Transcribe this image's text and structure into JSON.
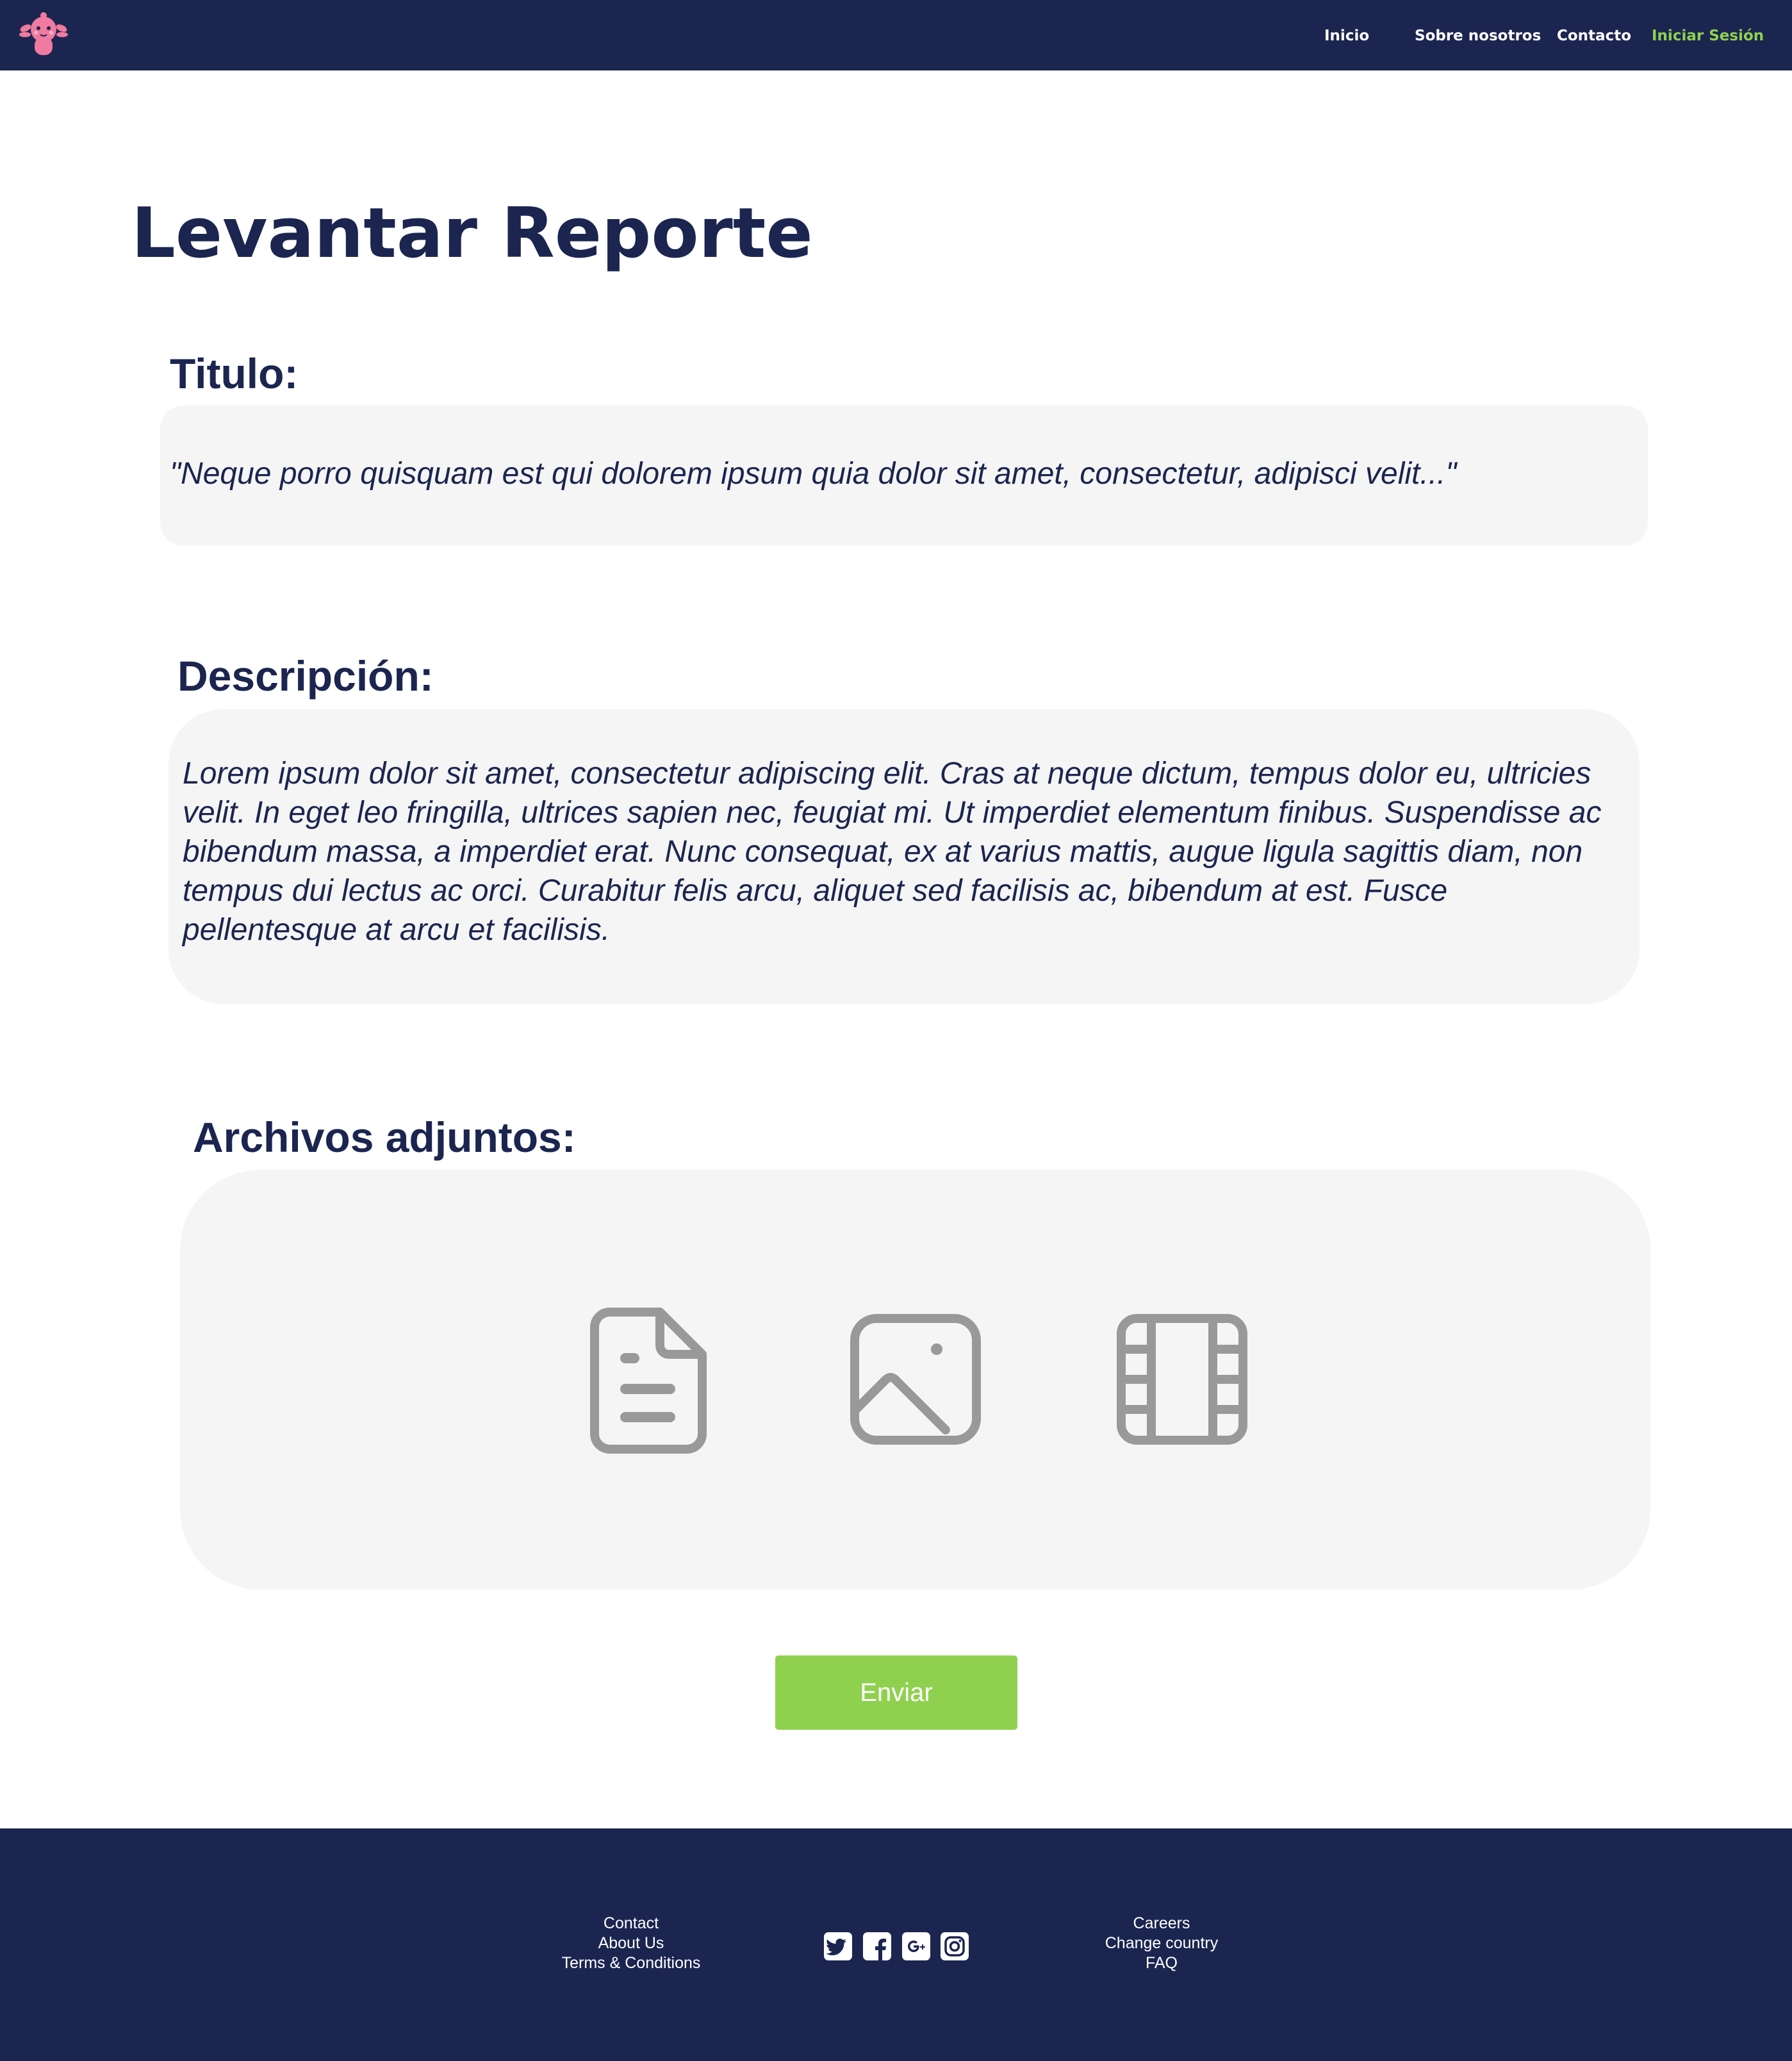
{
  "nav": {
    "logo_icon": "axolotl-logo-icon",
    "links": [
      "Inicio",
      "Sobre nosotros",
      "Contacto"
    ],
    "login_label": "Iniciar Sesión"
  },
  "page": {
    "title": "Levantar Reporte"
  },
  "form": {
    "title_label": "Titulo:",
    "title_value": "\"Neque porro quisquam est qui dolorem ipsum quia dolor sit amet, consectetur, adipisci velit...\"",
    "description_label": "Descripción:",
    "description_value": "Lorem ipsum dolor sit amet, consectetur adipiscing elit. Cras at neque dictum, tempus dolor eu, ultricies velit. In eget leo fringilla, ultrices sapien nec, feugiat mi. Ut imperdiet elementum finibus. Suspendisse ac bibendum massa, a imperdiet erat. Nunc consequat, ex at varius mattis, augue ligula sagittis diam, non tempus dui lectus ac orci. Curabitur felis arcu, aliquet sed facilisis ac, bibendum at est. Fusce pellentesque at arcu et facilisis.",
    "attachments_label": "Archivos adjuntos:",
    "attachment_icons": [
      "document-icon",
      "image-icon",
      "video-icon"
    ],
    "submit_label": "Enviar"
  },
  "footer": {
    "left_links": [
      "Contact",
      "About Us",
      "Terms & Conditions"
    ],
    "right_links": [
      "Careers",
      "Change country",
      "FAQ"
    ],
    "social_icons": [
      "twitter-icon",
      "facebook-icon",
      "google-plus-icon",
      "instagram-icon"
    ]
  },
  "colors": {
    "navy": "#1b2550",
    "accent_green": "#8fd14f",
    "field_bg": "#f5f5f5",
    "icon_gray": "#999999",
    "logo_pink": "#f07aa0"
  }
}
